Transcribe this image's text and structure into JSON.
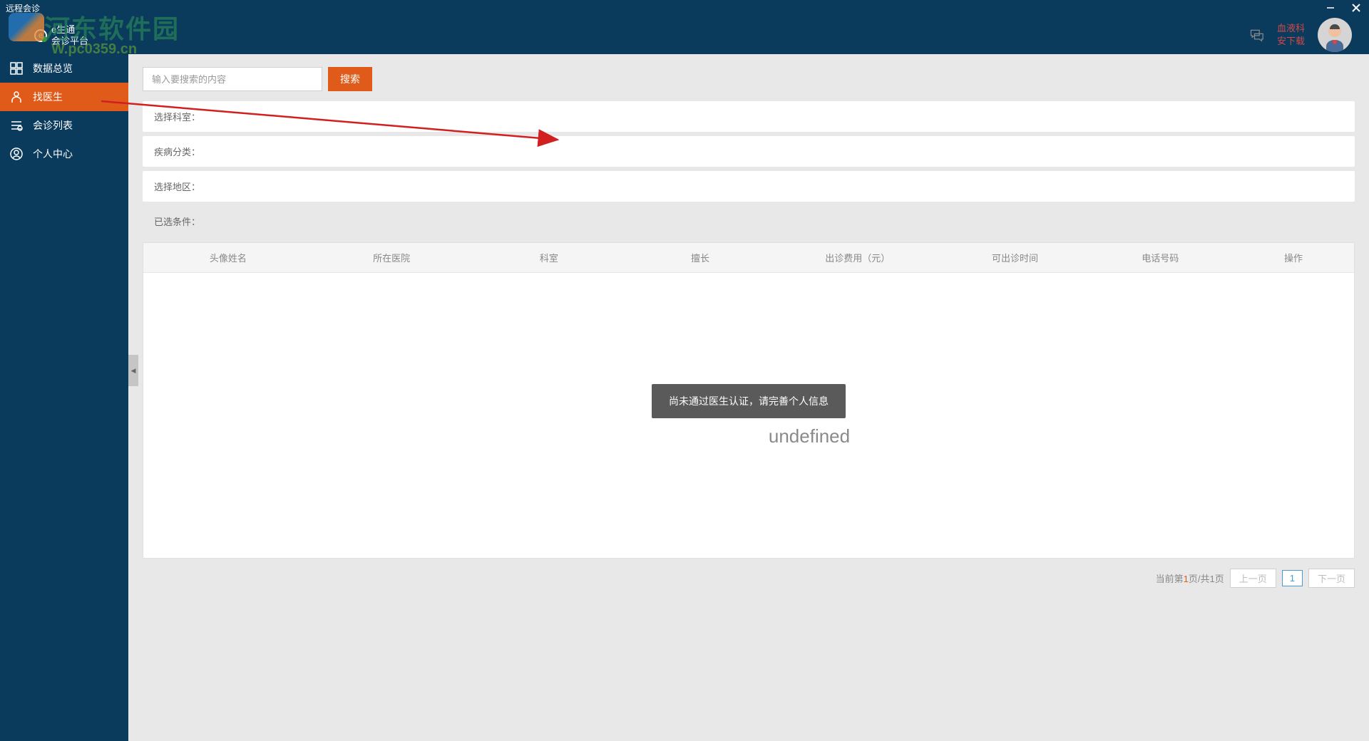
{
  "titlebar": {
    "title": "远程会诊"
  },
  "watermark": {
    "text": "河东软件园",
    "url": "W.pc0359.cn"
  },
  "logo": {
    "brand_top": "e生通",
    "brand_bottom": "会诊平台"
  },
  "header": {
    "user_dept": "血液科",
    "user_name": "安下载"
  },
  "sidebar": {
    "items": [
      {
        "label": "数据总览",
        "active": false
      },
      {
        "label": "找医生",
        "active": true
      },
      {
        "label": "会诊列表",
        "active": false
      },
      {
        "label": "个人中心",
        "active": false
      }
    ]
  },
  "search": {
    "placeholder": "输入要搜索的内容",
    "button": "搜索"
  },
  "filters": {
    "department": "选择科室：",
    "disease": "疾病分类：",
    "region": "选择地区：",
    "selected": "已选条件："
  },
  "table": {
    "columns": [
      {
        "label": "头像姓名",
        "width": "14%"
      },
      {
        "label": "所在医院",
        "width": "13%"
      },
      {
        "label": "科室",
        "width": "13%"
      },
      {
        "label": "擅长",
        "width": "12%"
      },
      {
        "label": "出诊费用（元）",
        "width": "14%"
      },
      {
        "label": "可出诊时间",
        "width": "12%"
      },
      {
        "label": "电话号码",
        "width": "12%"
      },
      {
        "label": "操作",
        "width": "10%"
      }
    ],
    "auth_message": "尚未通过医生认证，请完善个人信息",
    "undefined_text": "undefined"
  },
  "pagination": {
    "info_prefix": "当前第",
    "current": "1",
    "info_mid": "页/共",
    "total": "1",
    "info_suffix": "页",
    "prev": "上一页",
    "next": "下一页",
    "page1": "1"
  }
}
